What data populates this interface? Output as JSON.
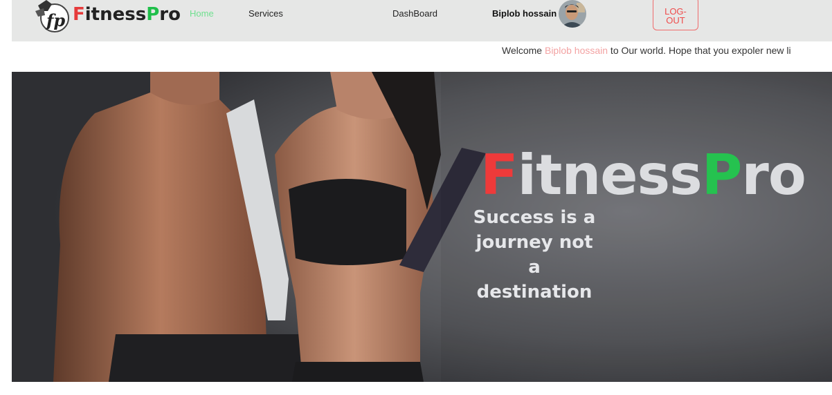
{
  "navbar": {
    "logo_icon": "fp-logo-icon",
    "brand_first": "F",
    "brand_mid": "itness",
    "brand_p": "P",
    "brand_last": "ro",
    "links": {
      "home": "Home",
      "services": "Services",
      "dashboard": "DashBoard"
    },
    "user_name": "Biplob hossain",
    "avatar_icon": "user-avatar",
    "logout_label": "LOG-OUT"
  },
  "welcome": {
    "prefix": "Welcome ",
    "name": "Biplob hossain",
    "suffix": " to Our world. Hope that you expoler new li"
  },
  "hero": {
    "title_first": "F",
    "title_mid": "itness",
    "title_p": "P",
    "title_last": "ro",
    "tagline": "Success is a journey not a destination"
  },
  "colors": {
    "accent_red": "#e63a3a",
    "accent_green": "#1fbf4a",
    "home_link": "#6fe08f",
    "navbar_bg": "#e6e7e6"
  }
}
